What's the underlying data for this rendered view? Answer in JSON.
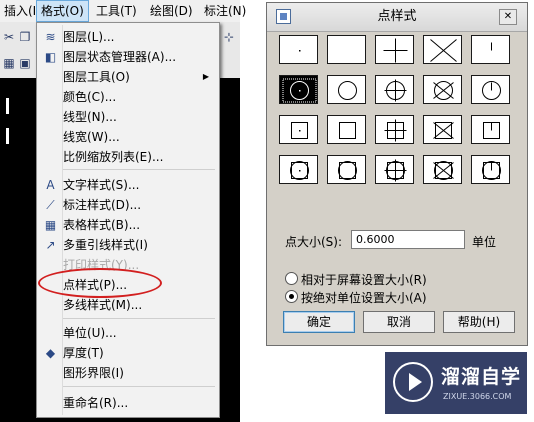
{
  "menubar": {
    "items": [
      {
        "label": "插入(I)"
      },
      {
        "label": "格式(O)",
        "active": true
      },
      {
        "label": "工具(T)"
      },
      {
        "label": "绘图(D)"
      },
      {
        "label": "标注(N)"
      }
    ]
  },
  "format_menu": {
    "items": [
      {
        "label": "图层(L)...",
        "icon": "layers-icon",
        "enabled": true
      },
      {
        "label": "图层状态管理器(A)...",
        "icon": "layer-state-icon",
        "enabled": true
      },
      {
        "label": "图层工具(O)",
        "icon": "",
        "enabled": true,
        "submenu": true
      },
      {
        "label": "颜色(C)...",
        "icon": "",
        "enabled": true
      },
      {
        "label": "线型(N)...",
        "icon": "",
        "enabled": true
      },
      {
        "label": "线宽(W)...",
        "icon": "",
        "enabled": true
      },
      {
        "label": "比例缩放列表(E)...",
        "icon": "",
        "enabled": true
      },
      {
        "label": "文字样式(S)...",
        "icon": "text-style-icon",
        "enabled": true
      },
      {
        "label": "标注样式(D)...",
        "icon": "dimension-style-icon",
        "enabled": true
      },
      {
        "label": "表格样式(B)...",
        "icon": "table-style-icon",
        "enabled": true
      },
      {
        "label": "多重引线样式(I)",
        "icon": "multileader-style-icon",
        "enabled": true
      },
      {
        "label": "打印样式(Y)...",
        "icon": "",
        "enabled": false
      },
      {
        "label": "点样式(P)...",
        "icon": "",
        "enabled": true,
        "highlighted": true
      },
      {
        "label": "多线样式(M)...",
        "icon": "",
        "enabled": true
      },
      {
        "label": "单位(U)...",
        "icon": "",
        "enabled": true
      },
      {
        "label": "厚度(T)",
        "icon": "thickness-icon",
        "enabled": true
      },
      {
        "label": "图形界限(I)",
        "icon": "",
        "enabled": true
      },
      {
        "label": "重命名(R)...",
        "icon": "",
        "enabled": true
      }
    ]
  },
  "dialog": {
    "title": "点样式",
    "close_label": "✕",
    "point_styles": [
      "dot",
      "none",
      "plus",
      "x",
      "tick",
      "circle-dot",
      "circle",
      "circle-plus",
      "circle-x",
      "circle-tick",
      "square-dot",
      "square",
      "square-plus",
      "square-x",
      "square-tick",
      "circle-square-dot",
      "circle-square",
      "circle-square-plus",
      "circle-square-x",
      "circle-square-tick"
    ],
    "selected_style_index": 5,
    "size_label": "点大小(S):",
    "size_value": "0.6000",
    "unit_label": "单位",
    "radio_options": [
      {
        "label": "相对于屏幕设置大小(R)",
        "checked": false
      },
      {
        "label": "按绝对单位设置大小(A)",
        "checked": true
      }
    ],
    "buttons": {
      "ok": "确定",
      "cancel": "取消",
      "help": "帮助(H)"
    }
  },
  "watermark": {
    "name": "溜溜自学",
    "url": "ZIXUE.3066.COM"
  },
  "colors": {
    "highlight_oval": "#d21f1f",
    "menu_bg": "#f2f2f2",
    "dialog_bg": "#d4d0c8",
    "watermark_bg": "#354067"
  }
}
